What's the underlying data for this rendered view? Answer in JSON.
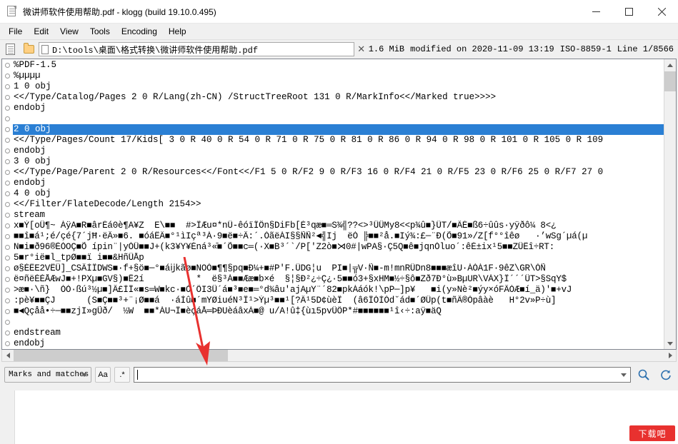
{
  "window": {
    "title": "微讲师软件使用帮助.pdf - klogg (build 19.10.0.495)",
    "icon": "document-icon",
    "minimize": "minimize-button",
    "maximize": "maximize-button",
    "close": "close-button"
  },
  "menu": {
    "items": [
      {
        "label": "File"
      },
      {
        "label": "Edit"
      },
      {
        "label": "View"
      },
      {
        "label": "Tools"
      },
      {
        "label": "Encoding"
      },
      {
        "label": "Help"
      }
    ]
  },
  "toolbar": {
    "new_label": "new-file-icon",
    "open_label": "open-folder-icon",
    "path": "D:\\tools\\桌面\\格式转换\\微讲师软件使用帮助.pdf",
    "close_file": "✕",
    "file_size": "1.6 MiB",
    "modified": "modified on 2020-11-09  13:19",
    "encoding": "ISO-8859-1",
    "line_info": "Line 1/8566"
  },
  "content": {
    "selected_index": 6,
    "lines": [
      "%PDF-1.5",
      "%µµµµ",
      "1 0 obj",
      "<</Type/Catalog/Pages 2 0 R/Lang(zh-CN) /StructTreeRoot 131 0 R/MarkInfo<</Marked true>>>>",
      "endobj",
      "",
      "2 0 obj",
      "<</Type/Pages/Count 17/Kids[ 3 0 R 40 0 R 54 0 R 71 0 R 75 0 R 81 0 R 86 0 R 94 0 R 98 0 R 101 0 R 105 0 R 109",
      "endobj",
      "3 0 obj",
      "<</Type/Page/Parent 2 0 R/Resources<</Font<</F1 5 0 R/F2 9 0 R/F3 16 0 R/F4 21 0 R/F5 23 0 R/F6 25 0 R/F7 27 0",
      "endobj",
      "4 0 obj",
      "<</Filter/FlateDecode/Length 2154>>",
      "stream",
      "x■Ý[oÛ¶~ ÀÿA■R■ârÈá0è¶A¥Z  E\\■■  #>ÏÆu¤*nÜ-êóïÏÔn§DiFb[É³qæ■═S¾╣??<>³ÛÛMy8<<p¾û■}ÜT/■ÄÈ■ß6÷ûûs·yÿðô¼ 8<¿",
      "■■î■á¹;é/çé{7´jĦ·ëÂ»■6. ■óáËÄ■°¹ìIçª³À·9■ë■÷Â:´.ÓãëÀI§§ÑÑ²◄╣Ij  ëÓ ╠■■²å.■Iý¾:£─¨Ð(Õ■91»/Z[f°°îêø   ·’wSg´µá(µ",
      "N■i■ð96®ÈÒOÇ■Õ ípin¨|yÒÛ■■J+(k3¥Y¥Èná³«̄■´Õ■■c═(·X■B³´`/P['Z2ò■⋊0#|wPA§·Ç5Q■ê■jqnÒluo´:êÈ±ix¹5■■ZÛËî÷RT:",
      "5■r°ië■l_tƿØ■■ï i■■&HñÛÅp",
      "ø§ÈËE2VËÛ]_CSÂÍÏDWS■·f+§ö■─°■áĳkãø■NOÒ■¶¶§pq■Ð¼+■#P'F.ÜDG¦u  PI■|╦V·Ñ■-m!mnRÜDn8■■■æîU·ÀÒÀ1F·9êZ\\GR\\ÒÑ",
      "ë¤ñëÈÈÅÆwJ■+!PXµ■GV§)■Ê2í          *  ë§³À■■Ææ■b×é  §¦§Ð²¿÷Ç¿·5■■ó3+§xHM■½÷§ô■Zð7Ð°ù»BµUR\\VÀX}Ï´´´ÜT>§SqY$",
      ">æ■·\\ñ}  ÒÒ·ßú³½µ■]Â£ÍÎ«■s═W■kc·■Ó´ÖI3Û´á■³■e■═°d¾âu'ajAµY¨´82■pkÀáók!\\pP─]p¥   ■i(y»Nè²■ýy×óFÂÒÆ■í_ä)'■+vJ",
      ":pè¥■■ÇJ      (S■Ç■■³+¨¡Ø■■á  ·áÍû■´mYØiuéN³Î¹>Ýµ³■■¹[?Ä¹5D¢ùèÏ  (â6ÎÒÌÓd˘ád■´ØÛp(t■ñÂ®Òpâàè   H°2v»P÷ù]",
      "■◄Qçåå•÷─■■zjI»gŨð/  ½W  ■■*ÀU¬Î■èçáÅ═ÞÐUèáâxÀ■@ u/A!û‡{ùı5pvÜÖP*#■■■■■■¹î‹÷:aÿ■äQ",
      "",
      "endstream",
      "endobj"
    ]
  },
  "search": {
    "scope_label": "Marks and matches",
    "case_button": "Aa",
    "regex_button": ".*",
    "input_value": "",
    "search_icon": "magnifier-icon",
    "refresh_icon": "refresh-icon"
  },
  "watermark": {
    "text": "下载吧"
  },
  "colors": {
    "selection": "#2a7fd4",
    "arrow": "#e8312f",
    "watermark_bg": "#e8312f"
  }
}
